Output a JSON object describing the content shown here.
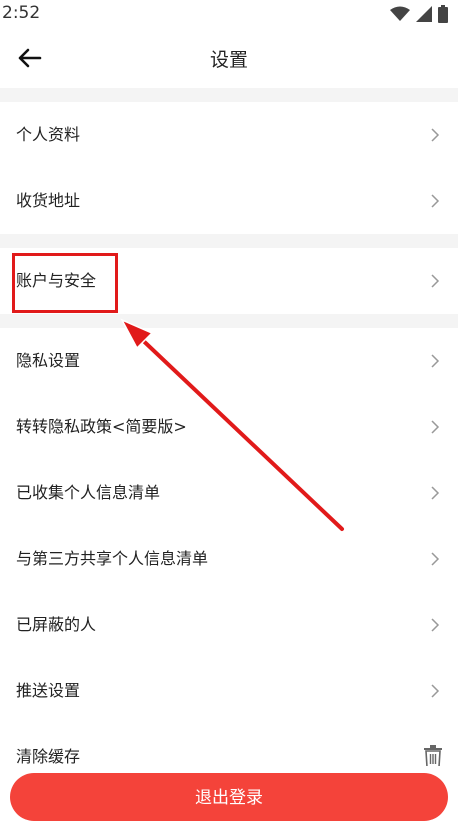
{
  "status_bar": {
    "time": "2:52",
    "icons": [
      "wifi-icon",
      "signal-icon",
      "battery-icon"
    ]
  },
  "header": {
    "title": "设置",
    "back_icon": "back-arrow-icon"
  },
  "settings": {
    "items": [
      {
        "label": "个人资料",
        "icon": "chevron-right-icon"
      },
      {
        "label": "收货地址",
        "icon": "chevron-right-icon"
      },
      {
        "label": "账户与安全",
        "icon": "chevron-right-icon",
        "highlighted": true
      },
      {
        "label": "隐私设置",
        "icon": "chevron-right-icon"
      },
      {
        "label": "转转隐私政策<简要版>",
        "icon": "chevron-right-icon"
      },
      {
        "label": "已收集个人信息清单",
        "icon": "chevron-right-icon"
      },
      {
        "label": "与第三方共享个人信息清单",
        "icon": "chevron-right-icon"
      },
      {
        "label": "已屏蔽的人",
        "icon": "chevron-right-icon"
      },
      {
        "label": "推送设置",
        "icon": "chevron-right-icon"
      },
      {
        "label": "清除缓存",
        "icon": "trash-icon"
      }
    ]
  },
  "logout": {
    "label": "退出登录"
  },
  "colors": {
    "accent": "#f4433a",
    "highlight": "#e11a1a",
    "section_gap": "#f4f4f4"
  }
}
